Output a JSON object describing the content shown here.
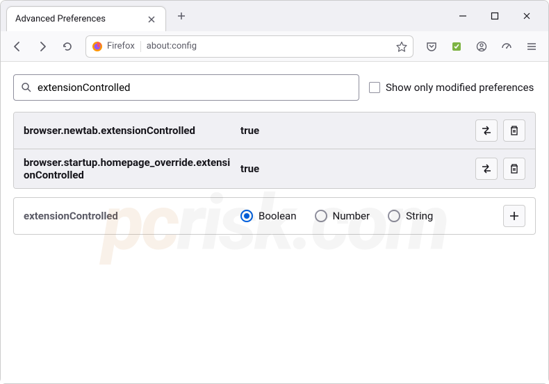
{
  "tab": {
    "title": "Advanced Preferences"
  },
  "urlbar": {
    "prefix": "Firefox",
    "address": "about:config"
  },
  "search": {
    "value": "extensionControlled",
    "modified_label": "Show only modified preferences"
  },
  "prefs": [
    {
      "name": "browser.newtab.extensionControlled",
      "value": "true"
    },
    {
      "name": "browser.startup.homepage_override.extensionControlled",
      "value": "true"
    }
  ],
  "add": {
    "name": "extensionControlled",
    "types": [
      "Boolean",
      "Number",
      "String"
    ],
    "selected": 0
  },
  "watermark": {
    "prefix": "pc",
    "suffix": "risk.com"
  }
}
